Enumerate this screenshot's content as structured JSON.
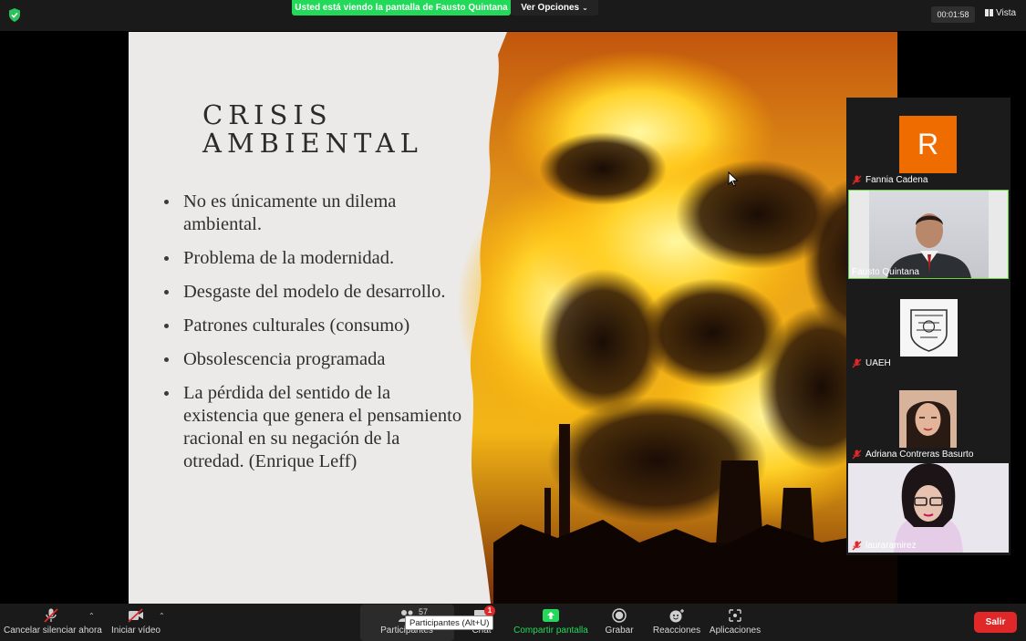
{
  "topbar": {
    "share_banner": "Usted está viendo la pantalla de Fausto Quintana",
    "view_options": "Ver Opciones",
    "timer": "00:01:58",
    "view_label": "Vista",
    "icons": {
      "security": "shield-check-icon",
      "view": "grid-icon"
    }
  },
  "slide": {
    "title_line1": "CRISIS",
    "title_line2": "AMBIENTAL",
    "bullets": [
      "No es únicamente un dilema ambiental.",
      "Problema de la modernidad.",
      "Desgaste del modelo de desarrollo.",
      "Patrones culturales (consumo)",
      "Obsolescencia programada",
      "La pérdida del sentido de la existencia que genera el pensamiento racional en su negación de la otredad. (Enrique Leff)"
    ],
    "image": "industrial-smoke-fire-photo"
  },
  "participants": [
    {
      "name": "Fannia Cadena",
      "avatar_letter": "R",
      "avatar_color": "#ef6d00",
      "muted": true
    },
    {
      "name": "Fausto Quintana",
      "video": true,
      "active_speaker": true,
      "muted": false
    },
    {
      "name": "UAEH",
      "avatar": "uaeh-seal-logo",
      "muted": true
    },
    {
      "name": "Adriana Contreras  Basurto",
      "avatar": "profile-photo",
      "muted": true
    },
    {
      "name": "lauraramirez",
      "video": true,
      "muted": true
    }
  ],
  "toolbar": {
    "unmute_label": "Cancelar silenciar ahora",
    "video_label": "Iniciar vídeo",
    "participants_label": "Participantes",
    "participants_count": "57",
    "chat_label": "Chat",
    "chat_badge": "1",
    "share_label": "Compartir pantalla",
    "record_label": "Grabar",
    "reactions_label": "Reacciones",
    "apps_label": "Aplicaciones",
    "leave_label": "Salir",
    "tooltip": "Participantes (Alt+U)"
  },
  "colors": {
    "accent_green": "#23d959",
    "leave_red": "#e02828",
    "speaker_border": "#68d042"
  }
}
